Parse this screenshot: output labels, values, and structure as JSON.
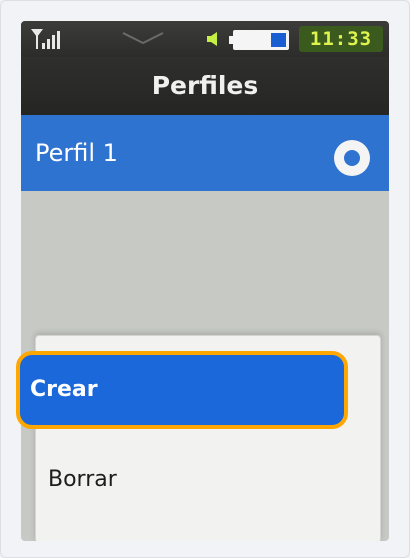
{
  "status": {
    "time": "11:33",
    "icons": [
      "signal-icon",
      "envelope-icon",
      "speaker-icon",
      "battery-icon"
    ]
  },
  "title": "Perfiles",
  "profile": {
    "name": "Perfil 1",
    "selected": true
  },
  "menu": {
    "items": [
      {
        "label": "Crear",
        "highlighted": true
      },
      {
        "label": "Borrar",
        "highlighted": false
      }
    ]
  },
  "colors": {
    "status_bar": "#2c2c2a",
    "selection_blue": "#1a68d9",
    "focus_outline": "#ffa600",
    "clock_text": "#dff34f"
  }
}
